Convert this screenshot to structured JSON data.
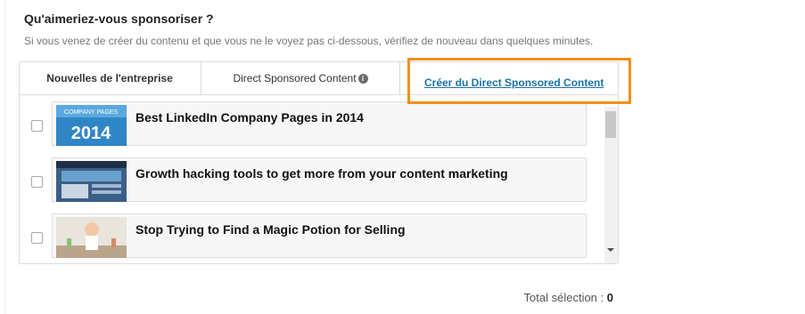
{
  "heading": "Qu'aimeriez-vous sponsoriser ?",
  "helptext": "Si vous venez de créer du contenu et que vous ne le voyez pas ci-dessous, vérifiez de nouveau dans quelques minutes.",
  "tabs": {
    "news_label": "Nouvelles de l'entreprise",
    "dsc_label": "Direct Sponsored Content",
    "info_glyph": "i"
  },
  "create_link": "Créer du Direct Sponsored Content",
  "accent_colors": {
    "highlight": "#f0911a",
    "link": "#1a73a8"
  },
  "items": [
    {
      "title": "Best LinkedIn Company Pages in 2014",
      "checked": false,
      "thumb_text_top": "COMPANY PAGES",
      "thumb_text_year": "2014"
    },
    {
      "title": "Growth hacking tools to get more from your content marketing",
      "checked": false
    },
    {
      "title": "Stop Trying to Find a Magic Potion for Selling",
      "checked": false
    }
  ],
  "total": {
    "label": "Total sélection :",
    "value": "0"
  }
}
